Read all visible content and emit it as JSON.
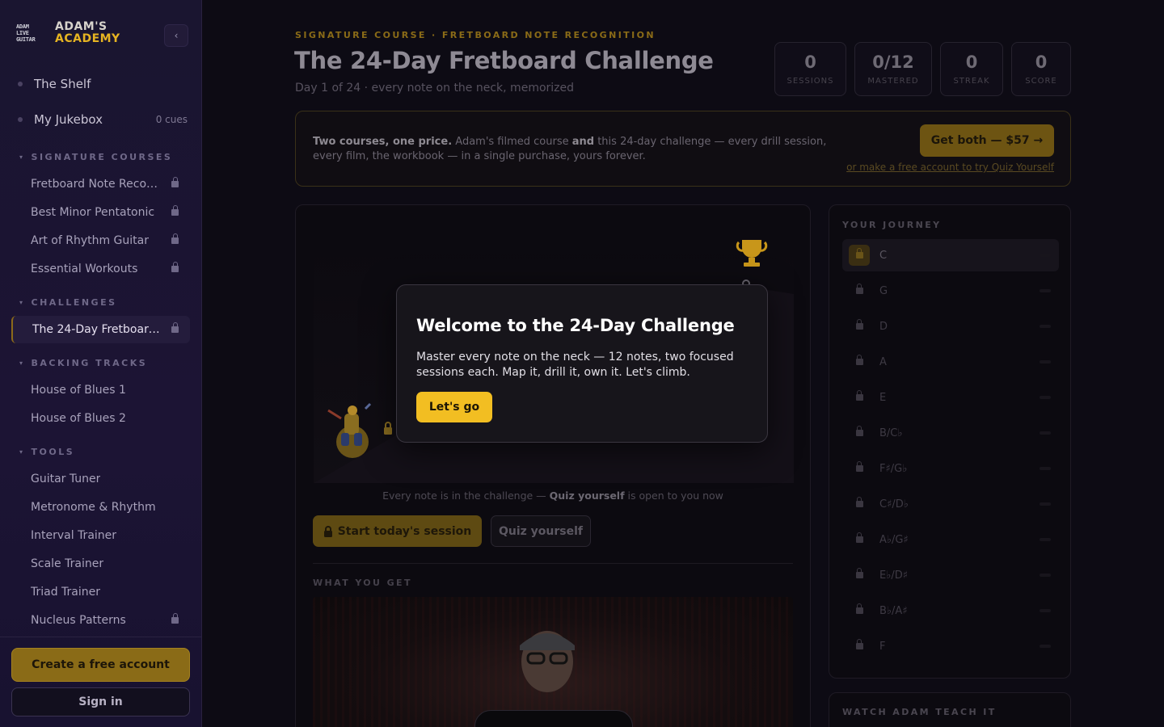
{
  "brand": {
    "logo_text": [
      "ADAM",
      "LIVE",
      "GUITAR"
    ],
    "line1": "ADAM'S",
    "line2": "ACADEMY",
    "collapse_icon": "‹"
  },
  "sidebar": {
    "top_items": [
      {
        "label": "The Shelf",
        "meta": ""
      },
      {
        "label": "My Jukebox",
        "meta": "0 cues"
      }
    ],
    "sections": {
      "signature": {
        "title": "SIGNATURE COURSES",
        "items": [
          "Fretboard Note Recog...",
          "Best Minor Pentatonic",
          "Art of Rhythm Guitar",
          "Essential Workouts"
        ]
      },
      "challenges": {
        "title": "CHALLENGES",
        "items": [
          "The 24-Day Fretboard ..."
        ]
      },
      "backing": {
        "title": "BACKING TRACKS",
        "items": [
          "House of Blues 1",
          "House of Blues 2"
        ]
      },
      "tools": {
        "title": "TOOLS",
        "items": [
          "Guitar Tuner",
          "Metronome & Rhythm",
          "Interval Trainer",
          "Scale Trainer",
          "Triad Trainer",
          "Nucleus Patterns"
        ]
      }
    },
    "create_label": "Create a free account",
    "signin_label": "Sign in"
  },
  "header": {
    "eyebrow": "SIGNATURE COURSE · FRETBOARD NOTE RECOGNITION",
    "title": "The 24-Day Fretboard Challenge",
    "subtitle": "Day 1 of 24 · every note on the neck, memorized"
  },
  "stats": [
    {
      "value": "0",
      "label": "SESSIONS"
    },
    {
      "value": "0/12",
      "label": "MASTERED"
    },
    {
      "value": "0",
      "label": "STREAK"
    },
    {
      "value": "0",
      "label": "SCORE"
    }
  ],
  "promo": {
    "lead": "Two courses, one price.",
    "text_a": " Adam's filmed course ",
    "and": "and",
    "text_b": " this 24-day challenge — every drill session, every film, the workbook — in a single purchase, yours forever.",
    "button": "Get both — $57 →",
    "link": "or make a free account to try Quiz Yourself"
  },
  "main": {
    "hint_a": "Every note is in the challenge — ",
    "hint_b": "Quiz yourself",
    "hint_c": " is open to you now",
    "start_label": "Start today's session",
    "quiz_label": "Quiz yourself",
    "wyg_title": "WHAT YOU GET"
  },
  "journey": {
    "title": "YOUR JOURNEY",
    "notes": [
      "C",
      "G",
      "D",
      "A",
      "E",
      "B/C♭",
      "F♯/G♭",
      "C♯/D♭",
      "A♭/G♯",
      "E♭/D♯",
      "B♭/A♯",
      "F"
    ]
  },
  "watch": {
    "title": "WATCH ADAM TEACH IT"
  },
  "modal": {
    "title": "Welcome to the 24-Day Challenge",
    "body": "Master every note on the neck — 12 notes, two focused sessions each. Map it, drill it, own it. Let's climb.",
    "button": "Let's go"
  },
  "colors": {
    "accent": "#f2be22",
    "brand_gold": "#e6b422",
    "sidebar_bg": "#1a1530"
  }
}
